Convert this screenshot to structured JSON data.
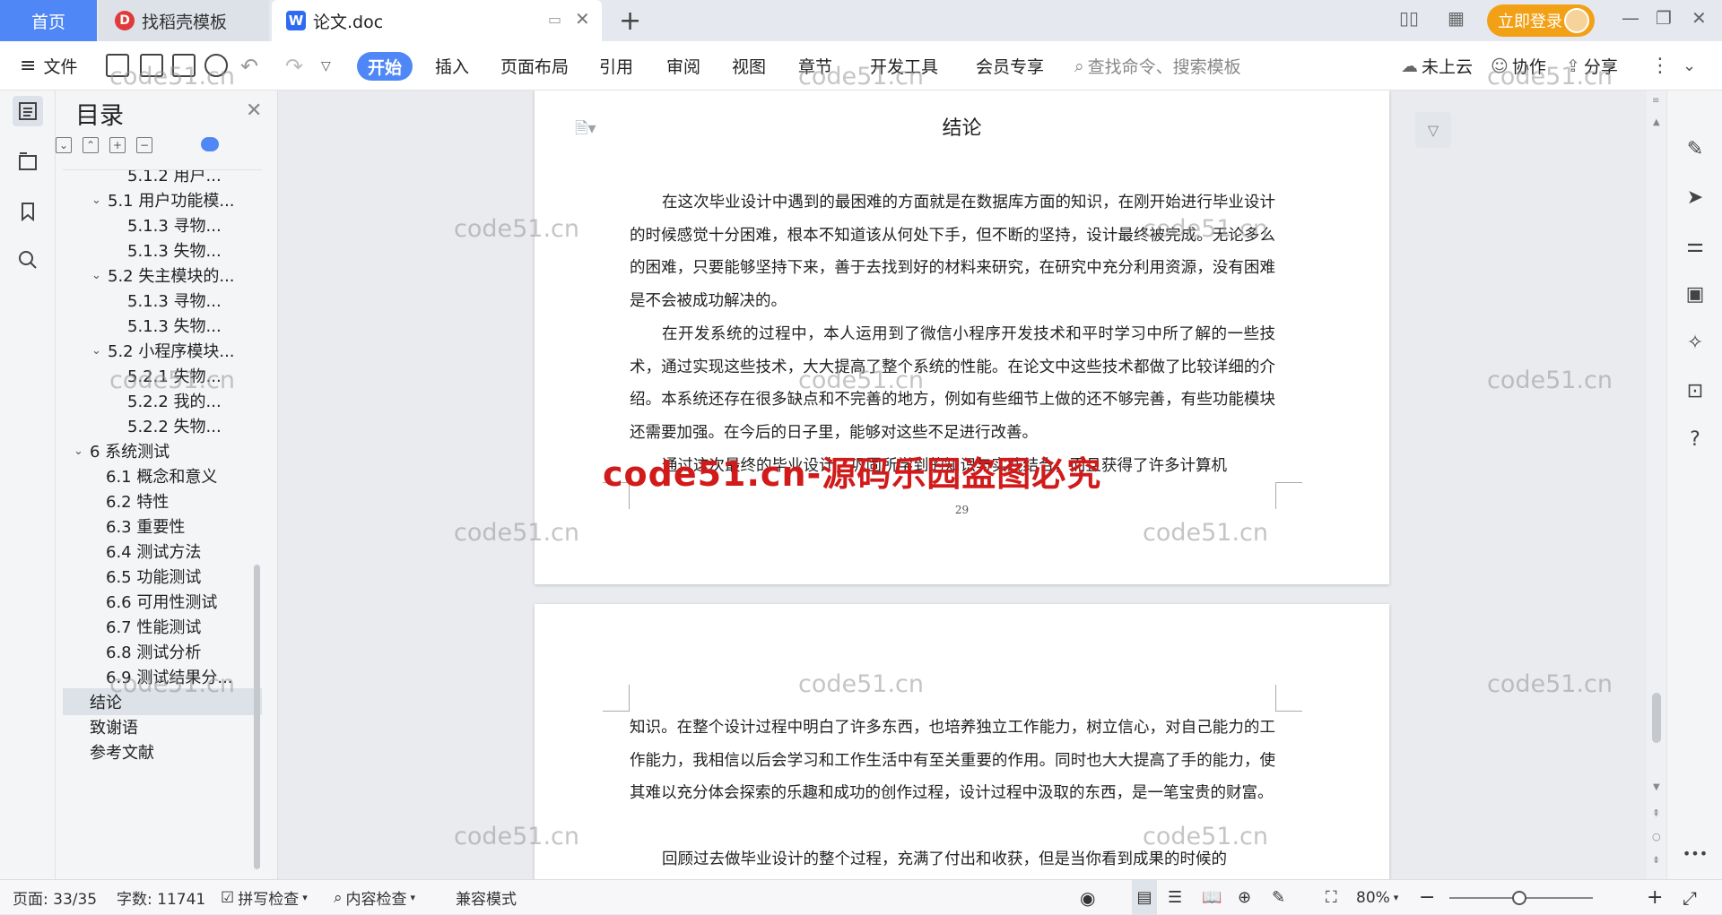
{
  "tabs": {
    "home": "首页",
    "templates": "找稻壳模板",
    "doc": "论文.doc"
  },
  "header": {
    "login": "立即登录"
  },
  "toolbar": {
    "file": "文件",
    "menu": [
      "开始",
      "插入",
      "页面布局",
      "引用",
      "审阅",
      "视图",
      "章节",
      "开发工具",
      "会员专享"
    ],
    "search_placeholder": "查找命令、搜索模板",
    "cloud": "未上云",
    "collab": "协作",
    "share": "分享"
  },
  "toc": {
    "title": "目录",
    "items": [
      {
        "label": "5.1.2 用户...",
        "level": 2
      },
      {
        "label": "5.1 用户功能模...",
        "level": 1,
        "expanded": true
      },
      {
        "label": "5.1.3 寻物...",
        "level": 2
      },
      {
        "label": "5.1.3 失物...",
        "level": 2
      },
      {
        "label": "5.2 失主模块的...",
        "level": 1,
        "expanded": true
      },
      {
        "label": "5.1.3 寻物...",
        "level": 2
      },
      {
        "label": "5.1.3 失物...",
        "level": 2
      },
      {
        "label": "5.2 小程序模块...",
        "level": 1,
        "expanded": true
      },
      {
        "label": "5.2.1 失物...",
        "level": 2
      },
      {
        "label": "5.2.2 我的...",
        "level": 2
      },
      {
        "label": "5.2.2 失物...",
        "level": 2
      },
      {
        "label": "6 系统测试",
        "level": 0,
        "expanded": true
      },
      {
        "label": "6.1 概念和意义",
        "level": 1
      },
      {
        "label": "6.2 特性",
        "level": 1
      },
      {
        "label": "6.3 重要性",
        "level": 1
      },
      {
        "label": "6.4 测试方法",
        "level": 1
      },
      {
        "label": "6.5  功能测试",
        "level": 1
      },
      {
        "label": "6.6 可用性测试",
        "level": 1
      },
      {
        "label": "6.7 性能测试",
        "level": 1
      },
      {
        "label": "6.8 测试分析",
        "level": 1
      },
      {
        "label": "6.9 测试结果分...",
        "level": 1
      },
      {
        "label": "结论",
        "level": 0,
        "selected": true
      },
      {
        "label": "致谢语",
        "level": 0
      },
      {
        "label": "参考文献",
        "level": 0
      }
    ]
  },
  "document": {
    "heading": "结论",
    "page1_paragraphs": [
      "在这次毕业设计中遇到的最困难的方面就是在数据库方面的知识，在刚开始进行毕业设计的时候感觉十分困难，根本不知道该从何处下手，但不断的坚持，设计最终被完成。无论多么的困难，只要能够坚持下来，善于去找到好的材料来研究，在研究中充分利用资源，没有困难是不会被成功解决的。",
      "在开发系统的过程中，本人运用到了微信小程序开发技术和平时学习中所了解的一些技术，通过实现这些技术，大大提高了整个系统的性能。在论文中这些技术都做了比较详细的介绍。本系统还存在很多缺点和不完善的地方，例如有些细节上做的还不够完善，有些功能模块还需要加强。在今后的日子里，能够对这些不足进行改善。",
      "通过这次最终的毕业设计，巩固所学到的知识与实践结合，而且获得了许多计算机"
    ],
    "page_number": "29",
    "page2_paragraphs": [
      "知识。在整个设计过程中明白了许多东西，也培养独立工作能力，树立信心，对自己能力的工作能力，我相信以后会学习和工作生活中有至关重要的作用。同时也大大提高了手的能力，使其难以充分体会探索的乐趣和成功的创作过程，设计过程中汲取的东西，是一笔宝贵的财富。",
      "回顾过去做毕业设计的整个过程，充满了付出和收获，但是当你看到成果的时候的"
    ]
  },
  "watermarks": {
    "small": "code51.cn",
    "big": "code51.cn-源码乐园盗图必究"
  },
  "status": {
    "page": "页面: 33/35",
    "words": "字数: 11741",
    "spell": "拼写检查",
    "content": "内容检查",
    "compat": "兼容模式",
    "zoom": "80%"
  },
  "colors": {
    "accent": "#4f87f6",
    "login": "#f2a116",
    "watermark_red": "#d11a1a"
  }
}
